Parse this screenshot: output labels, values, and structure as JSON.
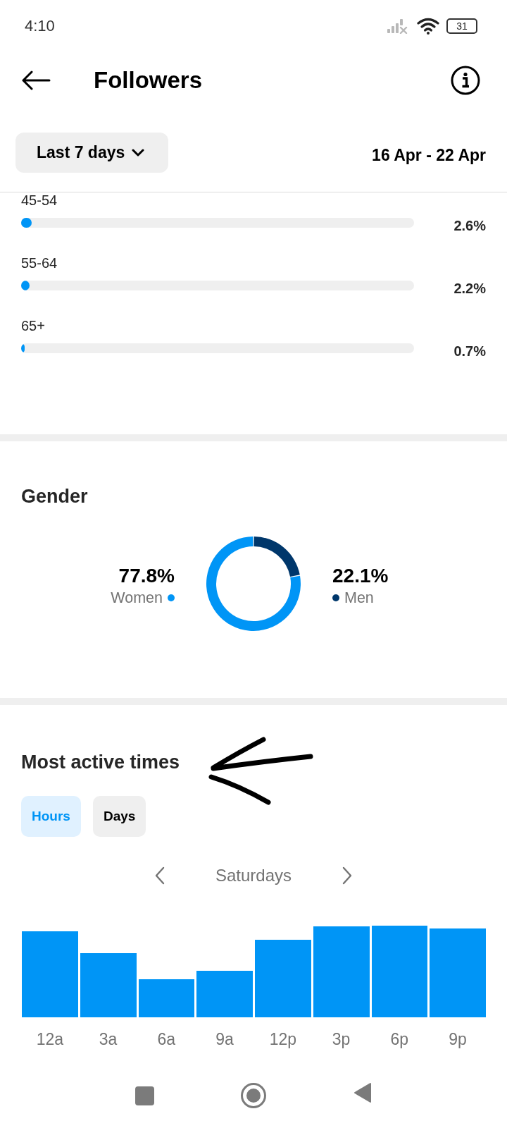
{
  "status_bar": {
    "time": "4:10",
    "battery": "31"
  },
  "header": {
    "title": "Followers"
  },
  "filter": {
    "range": "Last 7 days",
    "dates": "16 Apr - 22 Apr"
  },
  "age_ranges": [
    {
      "label": "45-54",
      "level": 0.026,
      "reading": "2.6%"
    },
    {
      "label": "55-64",
      "level": 0.022,
      "reading": "2.2%"
    },
    {
      "label": "65+",
      "level": 0.007,
      "reading": "0.7%"
    }
  ],
  "gender": {
    "title": "Gender",
    "legend": [
      {
        "value": "77.8%",
        "color": "#0095f6"
      },
      {
        "value": "22.1%",
        "color": "#00376b"
      }
    ],
    "chart_data": {
      "type": "donut",
      "categories": [
        "Women",
        "Men"
      ],
      "values": [
        77.8,
        22.1
      ]
    }
  },
  "active_times": {
    "title": "Most active times",
    "tabs": [
      {
        "label": "Hours",
        "selected": true
      },
      {
        "label": "Days",
        "selected": false
      }
    ],
    "period": "Saturdays",
    "axis_labels": [
      "12a",
      "3a",
      "6a",
      "9a",
      "12p",
      "3p",
      "6p",
      "9p"
    ]
  }
}
